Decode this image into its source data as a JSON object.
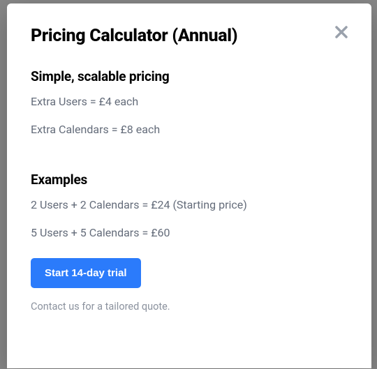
{
  "modal": {
    "title": "Pricing Calculator (Annual)",
    "close_label": "Close"
  },
  "pricing": {
    "heading": "Simple, scalable pricing",
    "users_line": "Extra Users = £4 each",
    "calendars_line": "Extra Calendars = £8 each"
  },
  "examples": {
    "heading": "Examples",
    "line1": "2 Users + 2 Calendars = £24 (Starting price)",
    "line2": "5 Users + 5 Calendars = £60"
  },
  "cta": {
    "trial_label": "Start 14-day trial",
    "contact_text": "Contact us for a tailored quote."
  }
}
